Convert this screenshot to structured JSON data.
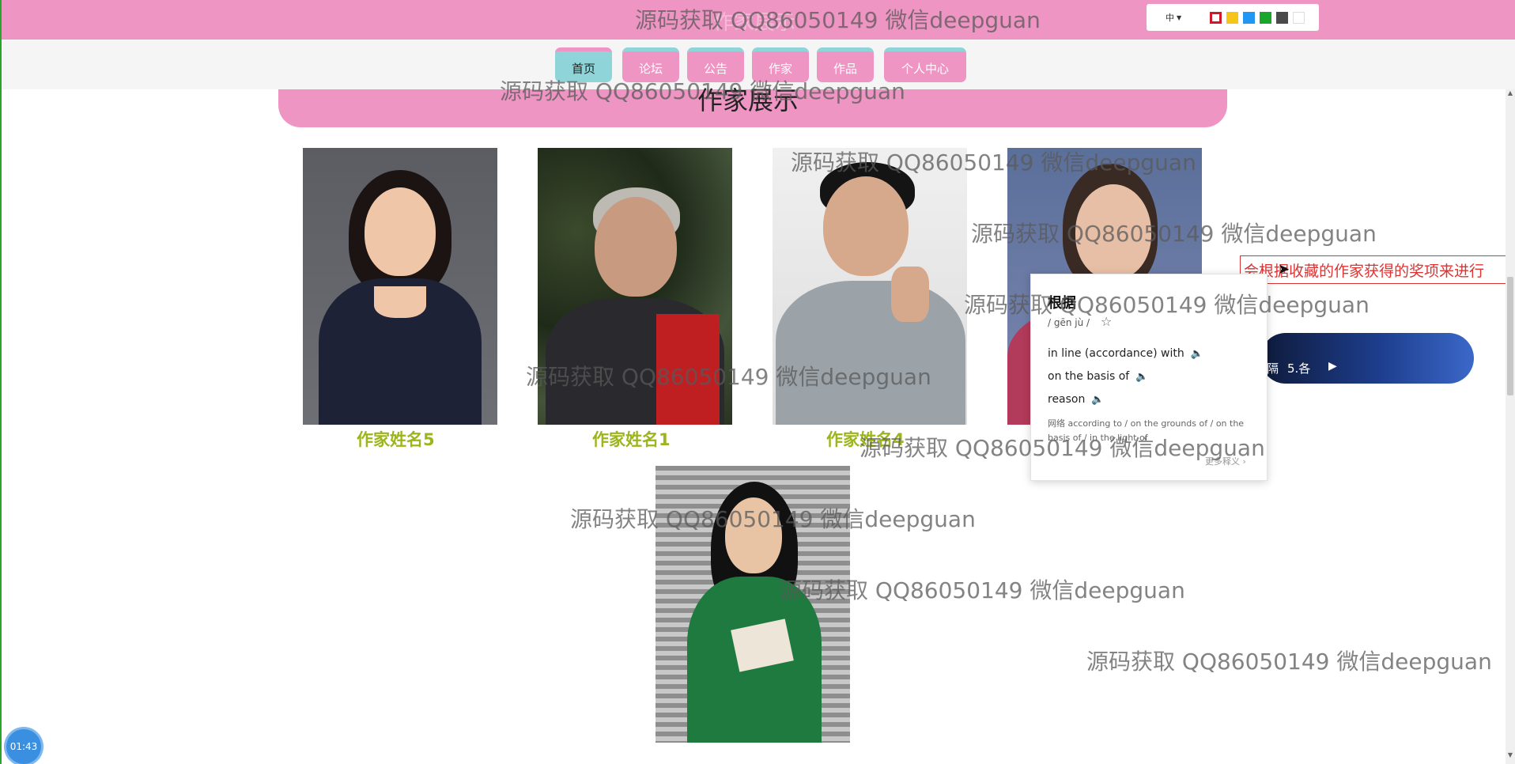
{
  "header": {
    "ghost_title": "作家展示",
    "language": "中",
    "theme_colors": [
      "#d0182b",
      "#f5c518",
      "#2196f3",
      "#1aa52b",
      "#4a4a4a",
      "#ffffff"
    ]
  },
  "nav": {
    "items": [
      {
        "label": "首页",
        "active": true
      },
      {
        "label": "论坛",
        "active": false
      },
      {
        "label": "公告",
        "active": false
      },
      {
        "label": "作家",
        "active": false
      },
      {
        "label": "作品",
        "active": false
      },
      {
        "label": "个人中心",
        "active": false
      }
    ]
  },
  "section": {
    "title": "作家展示"
  },
  "writers": [
    {
      "name": "作家姓名5"
    },
    {
      "name": "作家姓名1"
    },
    {
      "name": "作家姓名4"
    },
    {
      "name": ""
    },
    {
      "name": ""
    }
  ],
  "tooltip": {
    "text": "会根据收藏的作家获得的奖项来进行"
  },
  "player": {
    "text": "隔",
    "track": "5.各"
  },
  "dictionary": {
    "word": "根据",
    "pinyin": "/ gēn jù /",
    "definitions": [
      {
        "text": "in line  (accordance)  with"
      },
      {
        "text": "on the basis of"
      },
      {
        "text": "reason"
      }
    ],
    "web_label": "网络",
    "web_text": "according to / on the grounds of / on the basis of / in the light of",
    "more": "更多释义 ›"
  },
  "watermark": "源码获取 QQ86050149 微信deepguan",
  "timer": "01:43"
}
